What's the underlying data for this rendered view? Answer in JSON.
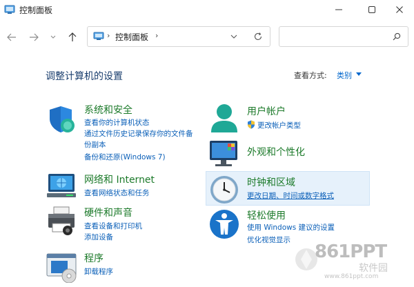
{
  "window": {
    "title": "控制面板"
  },
  "address": {
    "path": "控制面板",
    "chevron": "›"
  },
  "search": {
    "placeholder": ""
  },
  "header": {
    "title": "调整计算机的设置",
    "view_by_label": "查看方式:",
    "view_by_value": "类别"
  },
  "categories": {
    "system": {
      "title": "系统和安全",
      "links": [
        "查看你的计算机状态",
        "通过文件历史记录保存你的文件备",
        "份副本",
        "备份和还原(Windows 7)"
      ]
    },
    "network": {
      "title": "网络和 Internet",
      "links": [
        "查看网络状态和任务"
      ]
    },
    "hardware": {
      "title": "硬件和声音",
      "links": [
        "查看设备和打印机",
        "添加设备"
      ]
    },
    "programs": {
      "title": "程序",
      "links": [
        "卸载程序"
      ]
    },
    "user": {
      "title": "用户帐户",
      "links": [
        "更改帐户类型"
      ]
    },
    "appearance": {
      "title": "外观和个性化",
      "links": []
    },
    "clock": {
      "title": "时钟和区域",
      "links": [
        "更改日期、时间或数字格式"
      ]
    },
    "ease": {
      "title": "轻松使用",
      "links": [
        "使用 Windows 建议的设置",
        "优化视觉显示"
      ]
    }
  },
  "watermark": {
    "logo": "861PPT",
    "cn": "软件园",
    "url": "www.861ppt.com"
  },
  "colors": {
    "link": "#0a5fb8",
    "category_title": "#1c7a2a",
    "page_title": "#1a3e6e",
    "highlight": "#e6f1fb"
  }
}
